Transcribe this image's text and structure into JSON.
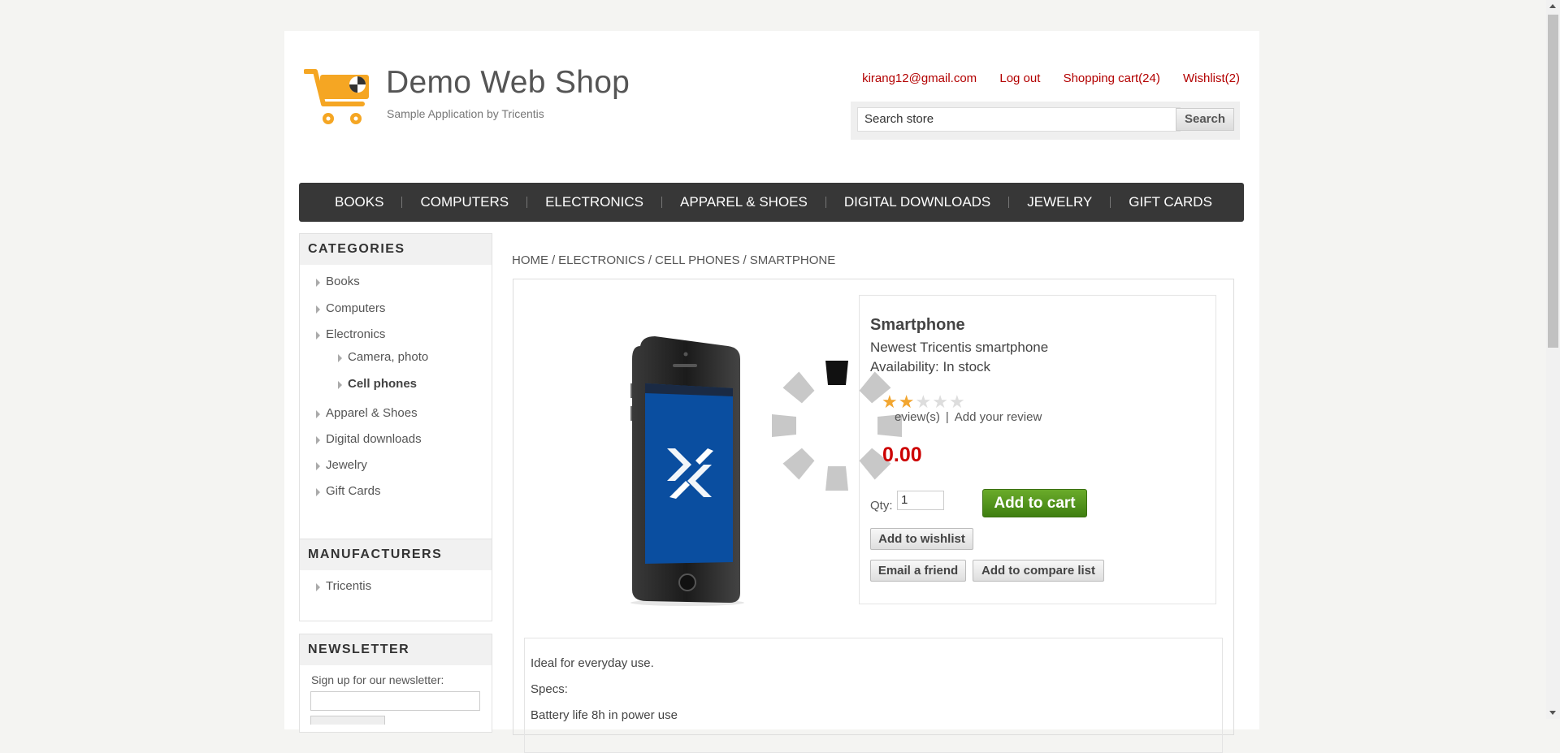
{
  "header": {
    "logo_title": "Demo Web Shop",
    "logo_subtitle": "Sample Application by Tricentis",
    "links": {
      "account": "kirang12@gmail.com",
      "logout": "Log out",
      "cart": "Shopping cart(24)",
      "wishlist": "Wishlist(2)"
    },
    "search": {
      "value": "Search store",
      "button": "Search"
    }
  },
  "menu": [
    "BOOKS",
    "COMPUTERS",
    "ELECTRONICS",
    "APPAREL & SHOES",
    "DIGITAL DOWNLOADS",
    "JEWELRY",
    "GIFT CARDS"
  ],
  "categories": {
    "title": "CATEGORIES",
    "items": [
      "Books",
      "Computers",
      "Electronics"
    ],
    "sub_items": [
      "Camera, photo",
      "Cell phones"
    ],
    "items_after": [
      "Apparel & Shoes",
      "Digital downloads",
      "Jewelry",
      "Gift Cards"
    ]
  },
  "manufacturers": {
    "title": "MANUFACTURERS",
    "items": [
      "Tricentis"
    ]
  },
  "newsletter": {
    "title": "NEWSLETTER",
    "label": "Sign up for our newsletter:"
  },
  "breadcrumb": [
    "HOME",
    "ELECTRONICS",
    "CELL PHONES",
    "SMARTPHONE"
  ],
  "product": {
    "name": "Smartphone",
    "short_description": "Newest Tricentis smartphone",
    "availability": "Availability: In stock",
    "rating_stars": 2,
    "rating_max": 5,
    "reviews_visible": "eview(s)",
    "add_review": "Add your review",
    "price_visible": "0.00",
    "qty_label": "Qty:",
    "qty_value": "1",
    "add_to_cart": "Add to cart",
    "add_to_wishlist": "Add to wishlist",
    "email_friend": "Email a friend",
    "compare": "Add to compare list"
  },
  "full_description": [
    "Ideal for everyday use.",
    "Specs:",
    "Battery life 8h in power use"
  ],
  "colors": {
    "link_red": "#b30000",
    "menu_bg": "#373737",
    "price_red": "#cc0000",
    "cart_green": "#4e8f1a",
    "star": "#f2a630"
  }
}
